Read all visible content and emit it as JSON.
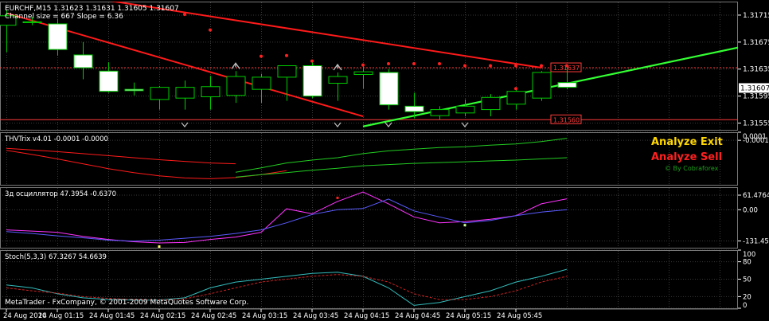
{
  "colors": {
    "background": "#000000",
    "grid": "#3a3a3a",
    "axis_text": "#ffffff",
    "bull_fill": "#000000",
    "bear_fill": "#ffffff",
    "wick": "#00cc00",
    "down_trend": "#ff1a1a",
    "up_trend": "#33ff33",
    "level_line": "#ff3b3b",
    "marker": "#ff2020",
    "arrow": "#bfbfbf",
    "thv_green": "#22cc22",
    "thv_red": "#ff1a1a",
    "osc_magenta": "#ff33ff",
    "osc_blue": "#5a5aff",
    "stoch_cyan": "#33bbbb",
    "stoch_red": "#cc2222",
    "analyze_exit": "#ffd700",
    "analyze_sell": "#ff2020",
    "cobraforex": "#1ca01c"
  },
  "header": {
    "symbol_line": "EURCHF,M15  1.31623 1.31631 1.31605 1.31607",
    "channel_line": "Channel size = 667 Slope = 6.36"
  },
  "watermark": "MetaTrader - FxCompany, © 2001-2009 MetaQuotes Software Corp.",
  "badges": {
    "analyze_exit": "Analyze Exit",
    "analyze_sell": "Analyze Sell",
    "by_cobraforex": "© By Cobraforex"
  },
  "chart_data": [
    {
      "type": "candlestick",
      "pane": "price",
      "symbol": "EURCHF",
      "timeframe": "M15",
      "ylim": [
        1.31545,
        1.31735
      ],
      "y_ticks": [
        "1.31715",
        "1.31675",
        "1.31635",
        "1.31595",
        "1.31555"
      ],
      "current_price": "1.31607",
      "level_labels": [
        {
          "label": "1.31637",
          "value": 1.31637
        },
        {
          "label": "1.31560",
          "value": 1.3156
        }
      ],
      "candles": [
        {
          "o": 1.317,
          "h": 1.31722,
          "l": 1.3166,
          "c": 1.31714
        },
        {
          "o": 1.31705,
          "h": 1.31712,
          "l": 1.317,
          "c": 1.31705
        },
        {
          "o": 1.31702,
          "h": 1.3171,
          "l": 1.31655,
          "c": 1.31664
        },
        {
          "o": 1.31656,
          "h": 1.31675,
          "l": 1.3162,
          "c": 1.31637
        },
        {
          "o": 1.31632,
          "h": 1.31645,
          "l": 1.316,
          "c": 1.31602
        },
        {
          "o": 1.31605,
          "h": 1.31615,
          "l": 1.31596,
          "c": 1.31603
        },
        {
          "o": 1.3159,
          "h": 1.3161,
          "l": 1.31575,
          "c": 1.31608
        },
        {
          "o": 1.31592,
          "h": 1.31618,
          "l": 1.31575,
          "c": 1.31608
        },
        {
          "o": 1.31594,
          "h": 1.31625,
          "l": 1.31575,
          "c": 1.31609
        },
        {
          "o": 1.31596,
          "h": 1.31632,
          "l": 1.31585,
          "c": 1.31624
        },
        {
          "o": 1.31605,
          "h": 1.31628,
          "l": 1.31585,
          "c": 1.31623
        },
        {
          "o": 1.31623,
          "h": 1.3164,
          "l": 1.31588,
          "c": 1.3164
        },
        {
          "o": 1.3164,
          "h": 1.31648,
          "l": 1.31592,
          "c": 1.31595
        },
        {
          "o": 1.31614,
          "h": 1.3163,
          "l": 1.31588,
          "c": 1.31624
        },
        {
          "o": 1.31627,
          "h": 1.3164,
          "l": 1.31606,
          "c": 1.31631
        },
        {
          "o": 1.3163,
          "h": 1.31635,
          "l": 1.31575,
          "c": 1.31582
        },
        {
          "o": 1.3158,
          "h": 1.316,
          "l": 1.31562,
          "c": 1.31572
        },
        {
          "o": 1.31566,
          "h": 1.3158,
          "l": 1.3156,
          "c": 1.31575
        },
        {
          "o": 1.3157,
          "h": 1.3159,
          "l": 1.31565,
          "c": 1.3158
        },
        {
          "o": 1.31575,
          "h": 1.31598,
          "l": 1.31565,
          "c": 1.31593
        },
        {
          "o": 1.31583,
          "h": 1.31605,
          "l": 1.31575,
          "c": 1.31602
        },
        {
          "o": 1.31592,
          "h": 1.31632,
          "l": 1.31588,
          "c": 1.3163
        },
        {
          "o": 1.31615,
          "h": 1.31638,
          "l": 1.31605,
          "c": 1.31608
        }
      ],
      "down_trend_line": {
        "points": [
          [
            0,
            1.3176
          ],
          [
            21,
            1.31637
          ]
        ]
      },
      "down_trend_lower": {
        "points": [
          [
            0,
            1.31718
          ],
          [
            14,
            1.31565
          ]
        ]
      },
      "up_trend_line": {
        "points": [
          [
            14,
            1.3155
          ],
          [
            30,
            1.31677
          ]
        ]
      },
      "red_markers": [
        {
          "i": 7,
          "v": 1.31716
        },
        {
          "i": 8,
          "v": 1.31693
        },
        {
          "i": 10,
          "v": 1.31654
        },
        {
          "i": 11,
          "v": 1.31655
        },
        {
          "i": 12,
          "v": 1.31647
        },
        {
          "i": 14,
          "v": 1.31641
        },
        {
          "i": 15,
          "v": 1.31643
        },
        {
          "i": 16,
          "v": 1.31643
        },
        {
          "i": 17,
          "v": 1.31643
        },
        {
          "i": 18,
          "v": 1.3164
        },
        {
          "i": 19,
          "v": 1.3164
        },
        {
          "i": 20,
          "v": 1.3164
        },
        {
          "i": 21,
          "v": 1.3164
        },
        {
          "i": 22,
          "v": 1.3164
        },
        {
          "i": 20,
          "v": 1.31606
        }
      ],
      "arrows_up": [
        9,
        13
      ],
      "arrows_down": [
        7,
        13,
        15,
        18
      ]
    },
    {
      "type": "line",
      "pane": "THVTrix",
      "title": "THVTrix v4.01 -0.0001 -0.0000",
      "ylim": [
        -0.0012,
        0.0001
      ],
      "y_ticks": [
        "0.0001",
        "-0.0001"
      ],
      "series": [
        {
          "color": "thv_red",
          "values": [
            -0.0003,
            -0.00034,
            -0.00038,
            -0.00043,
            -0.00048,
            -0.00053,
            -0.00058,
            -0.00062,
            -0.00066,
            -0.00068
          ]
        },
        {
          "color": "thv_red",
          "values": [
            -0.00035,
            -0.00045,
            -0.00056,
            -0.00068,
            -0.0008,
            -0.0009,
            -0.00098,
            -0.00103,
            -0.00105,
            -0.00102,
            -0.00095,
            -0.00085
          ]
        },
        {
          "color": "thv_green",
          "values": [
            null,
            null,
            null,
            null,
            null,
            null,
            null,
            null,
            null,
            -0.00089,
            -0.00078,
            -0.00066,
            -0.00059,
            -0.00053,
            -0.00043,
            -0.00036,
            -0.00032,
            -0.00028,
            -0.00026,
            -0.00022,
            -0.00019,
            -0.00013,
            -5e-05
          ]
        },
        {
          "color": "thv_green",
          "values": [
            null,
            null,
            null,
            null,
            null,
            null,
            null,
            null,
            null,
            -0.00101,
            -0.00095,
            -0.0009,
            -0.00084,
            -0.00079,
            -0.00073,
            -0.0007,
            -0.00067,
            -0.00065,
            -0.00063,
            -0.00061,
            -0.00059,
            -0.00056,
            -0.00053
          ]
        }
      ]
    },
    {
      "type": "line",
      "pane": "3d oscillator",
      "title": "3д осциллятор 47.3954 -0.6370",
      "ylim": [
        -160,
        95
      ],
      "y_ticks": [
        "61.4764",
        "0.00",
        "-131.4526"
      ],
      "series": [
        {
          "color": "osc_magenta",
          "values": [
            -85,
            -90,
            -95,
            -112,
            -125,
            -135,
            -140,
            -138,
            -125,
            -115,
            -95,
            4,
            -17,
            35,
            75,
            25,
            -30,
            -55,
            -50,
            -40,
            -25,
            25,
            46
          ]
        },
        {
          "color": "osc_blue",
          "values": [
            -92,
            -100,
            -110,
            -118,
            -128,
            -132,
            -128,
            -120,
            -112,
            -100,
            -85,
            -55,
            -20,
            0,
            5,
            45,
            -5,
            -30,
            -55,
            -45,
            -25,
            -10,
            0
          ]
        }
      ],
      "points": [
        {
          "i": 6,
          "v": -155,
          "color": "#ffff66"
        },
        {
          "i": 13,
          "v": 50,
          "color": "#ff2020"
        },
        {
          "i": 18,
          "v": -65,
          "color": "#ccff99"
        }
      ]
    },
    {
      "type": "line",
      "pane": "Stochastic",
      "title": "Stoch(5,3,3) 67.3267 54.6639",
      "ylim": [
        0,
        100
      ],
      "y_ticks": [
        "100",
        "80",
        "50",
        "20",
        "0"
      ],
      "series": [
        {
          "color": "stoch_cyan",
          "values": [
            40,
            35,
            25,
            18,
            15,
            14,
            14,
            18,
            35,
            45,
            50,
            55,
            60,
            62,
            55,
            35,
            5,
            10,
            20,
            30,
            45,
            55,
            67
          ]
        },
        {
          "color": "stoch_red",
          "values": [
            35,
            30,
            26,
            20,
            17,
            15,
            14,
            16,
            25,
            35,
            45,
            50,
            55,
            58,
            55,
            45,
            25,
            15,
            15,
            20,
            30,
            45,
            55
          ]
        }
      ]
    }
  ],
  "x_axis": {
    "labels": [
      "24 Aug 2010",
      "24 Aug 01:15",
      "24 Aug 01:45",
      "24 Aug 02:15",
      "24 Aug 02:45",
      "24 Aug 03:15",
      "24 Aug 03:45",
      "24 Aug 04:15",
      "24 Aug 04:45",
      "24 Aug 05:15",
      "24 Aug 05:45"
    ]
  }
}
